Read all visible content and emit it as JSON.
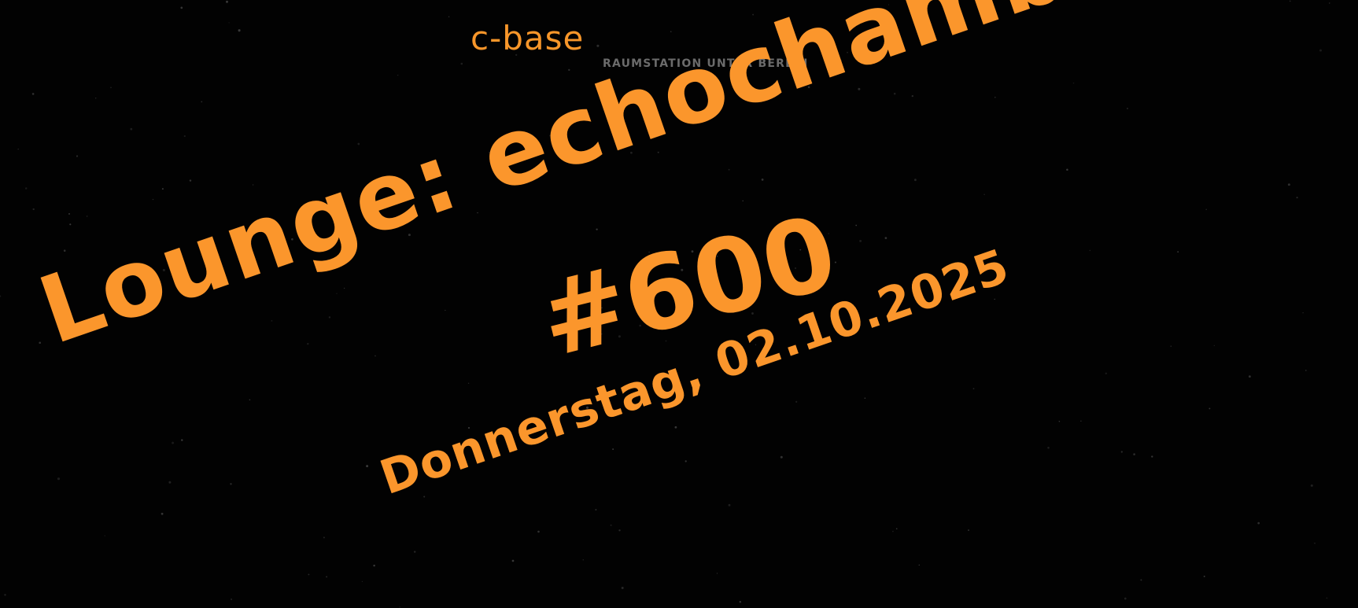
{
  "logo": {
    "mark": "c-base",
    "subtitle": "RAUMSTATION UNTER BERLIN"
  },
  "event": {
    "title": "Lounge: echochamber",
    "number": "#600",
    "date": "Donnerstag, 02.10.2025"
  },
  "colors": {
    "background": "#020202",
    "accent": "#fb962c",
    "logo_subtitle": "#6b6b6b",
    "stars": "#3a3a3a"
  }
}
